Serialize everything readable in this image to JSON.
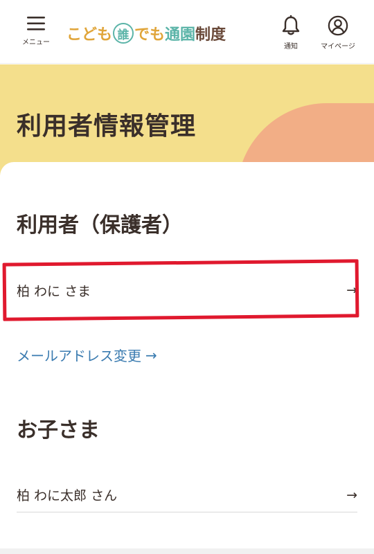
{
  "header": {
    "menu_label": "メニュー",
    "logo": {
      "part1": "こども",
      "badge": "誰",
      "part2": "でも",
      "part3": "通園",
      "part4": "制度"
    },
    "notify_label": "通知",
    "mypage_label": "マイページ"
  },
  "hero": {
    "title": "利用者情報管理"
  },
  "guardian": {
    "section_title": "利用者（保護者）",
    "name": "柏 わに さま",
    "arrow": "→",
    "email_link": "メールアドレス変更",
    "email_arrow": "→"
  },
  "children": {
    "section_title": "お子さま",
    "name": "柏 わに太郎 さん",
    "arrow": "→"
  },
  "colors": {
    "hero_bg": "#f4df8c",
    "hero_blob": "#f2ae86",
    "link": "#3a7bb0",
    "highlight": "#e0192e",
    "logo_yellow": "#e0a53a",
    "logo_teal": "#5bb4a8"
  }
}
